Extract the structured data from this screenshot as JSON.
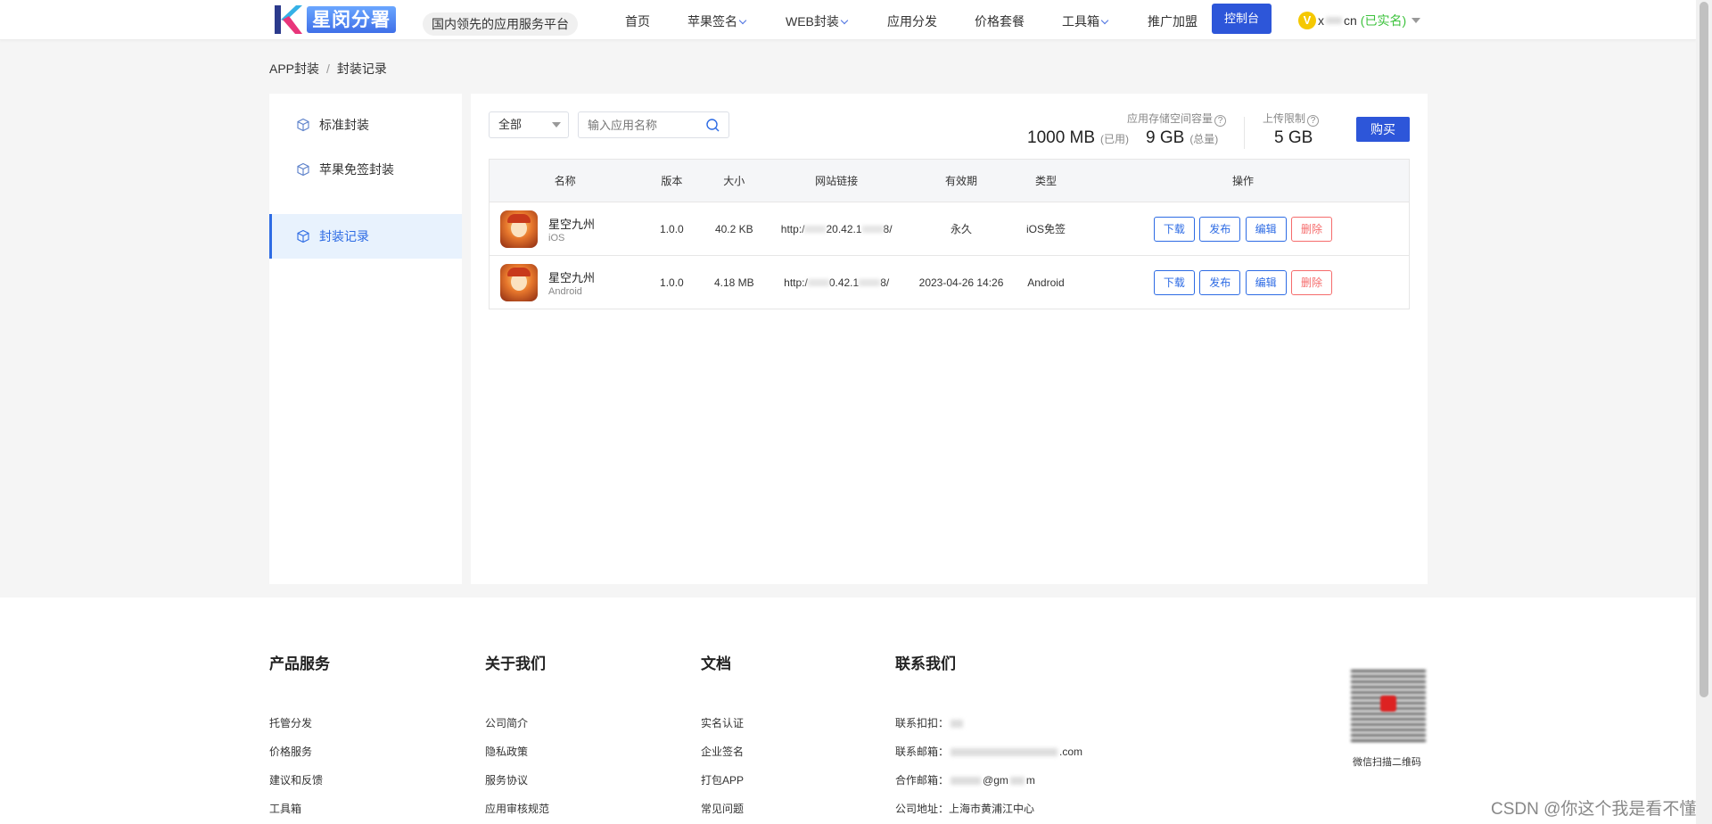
{
  "header": {
    "logo_text": "星闵分署",
    "slogan": "国内领先的应用服务平台",
    "nav": [
      {
        "label": "首页",
        "dropdown": false
      },
      {
        "label": "苹果签名",
        "dropdown": true
      },
      {
        "label": "WEB封装",
        "dropdown": true
      },
      {
        "label": "应用分发",
        "dropdown": false
      },
      {
        "label": "价格套餐",
        "dropdown": false
      },
      {
        "label": "工具箱",
        "dropdown": true
      },
      {
        "label": "推广加盟",
        "dropdown": false
      }
    ],
    "console_label": "控制台",
    "user": {
      "badge": "V",
      "name_start": "x",
      "name_end": "cn",
      "status": "(已实名)"
    }
  },
  "breadcrumb": {
    "root": "APP封装",
    "separator": "/",
    "current": "封装记录"
  },
  "sidebar": {
    "items": [
      {
        "label": "标准封装",
        "active": false
      },
      {
        "label": "苹果免签封装",
        "active": false
      },
      {
        "label": "封装记录",
        "active": true
      }
    ]
  },
  "filters": {
    "select_value": "全部",
    "search_placeholder": "输入应用名称"
  },
  "stats": {
    "storage_label": "应用存储空间容量",
    "used_value": "1000 MB",
    "used_suffix": "(已用)",
    "total_value": "9 GB",
    "total_suffix": "(总量)",
    "upload_label": "上传限制",
    "upload_value": "5 GB",
    "help_glyph": "?",
    "buy_label": "购买"
  },
  "table": {
    "headers": [
      "名称",
      "版本",
      "大小",
      "网站链接",
      "有效期",
      "类型",
      "操作"
    ],
    "rows": [
      {
        "name": "星空九州",
        "platform": "iOS",
        "version": "1.0.0",
        "size": "40.2 KB",
        "url_a": "http:/",
        "url_b": "20.42.1",
        "url_c": "8/",
        "validity": "永久",
        "type": "iOS免签"
      },
      {
        "name": "星空九州",
        "platform": "Android",
        "version": "1.0.0",
        "size": "4.18 MB",
        "url_a": "http:/",
        "url_b": "0.42.1",
        "url_c": "8/",
        "validity": "2023-04-26 14:26",
        "type": "Android"
      }
    ],
    "actions": {
      "download": "下载",
      "publish": "发布",
      "edit": "编辑",
      "delete": "删除"
    }
  },
  "footer": {
    "products": {
      "title": "产品服务",
      "links": [
        "托管分发",
        "价格服务",
        "建议和反馈",
        "工具箱"
      ]
    },
    "about": {
      "title": "关于我们",
      "links": [
        "公司简介",
        "隐私政策",
        "服务协议",
        "应用审核规范"
      ]
    },
    "docs": {
      "title": "文档",
      "links": [
        "实名认证",
        "企业签名",
        "打包APP",
        "常见问题"
      ]
    },
    "contact": {
      "title": "联系我们",
      "qq_label": "联系扣扣：",
      "email_label": "联系邮箱：",
      "email_tail": ".com",
      "coop_label": "合作邮箱：",
      "coop_mid": "@gm",
      "coop_tail": "m",
      "address_label": "公司地址：",
      "address": "上海市黄浦江中心"
    },
    "qr_caption": "微信扫描二维码"
  },
  "watermark": "CSDN @你这个我是看不懂"
}
